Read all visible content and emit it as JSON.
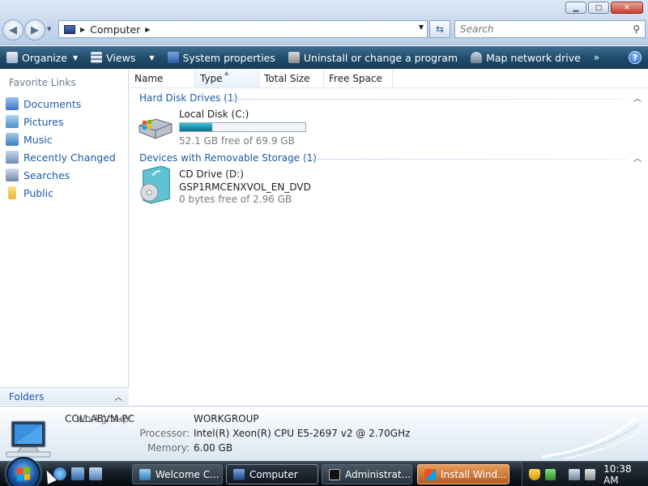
{
  "window": {
    "address_crumb": "Computer",
    "search_placeholder": "Search",
    "minimize": "▁",
    "maximize": "▢",
    "close": "✕"
  },
  "toolbar": {
    "items": [
      {
        "label": "Organize",
        "icon": "organize-icon",
        "has_dropdown": true
      },
      {
        "label": "Views",
        "icon": "views-icon",
        "has_dropdown": true
      },
      {
        "label": "System properties",
        "icon": "system-properties-icon"
      },
      {
        "label": "Uninstall or change a program",
        "icon": "uninstall-icon"
      },
      {
        "label": "Map network drive",
        "icon": "network-drive-icon"
      }
    ],
    "more": "»",
    "help": "?"
  },
  "navpane": {
    "title": "Favorite Links",
    "items": [
      {
        "label": "Documents",
        "icon": "documents-icon",
        "color": "#3b78c9"
      },
      {
        "label": "Pictures",
        "icon": "pictures-icon",
        "color": "#4a8ec9"
      },
      {
        "label": "Music",
        "icon": "music-icon",
        "color": "#3a7fbf"
      },
      {
        "label": "Recently Changed",
        "icon": "recently-changed-icon",
        "color": "#6b8fb8"
      },
      {
        "label": "Searches",
        "icon": "searches-icon",
        "color": "#6f86a8"
      },
      {
        "label": "Public",
        "icon": "public-icon",
        "color": "#e8b631"
      }
    ],
    "folders_label": "Folders"
  },
  "columns": [
    "Name",
    "Type",
    "Total Size",
    "Free Space"
  ],
  "groups": [
    {
      "title": "Hard Disk Drives (1)",
      "drives": [
        {
          "name": "Local Disk (C:)",
          "free_text": "52.1 GB free of 69.9 GB",
          "used_fraction": 0.255,
          "icon": "hard-disk-icon"
        }
      ]
    },
    {
      "title": "Devices with Removable Storage (1)",
      "drives": [
        {
          "name": "CD Drive (D:)",
          "label": "GSP1RMCENXVOL_EN_DVD",
          "free_text": "0 bytes free of 2.96 GB",
          "icon": "cd-drive-icon"
        }
      ]
    }
  ],
  "details": {
    "pc_name": "COLLABVM-PC",
    "rows": [
      {
        "label": "Workgroup:",
        "value": "WORKGROUP"
      },
      {
        "label": "Processor:",
        "value": "Intel(R) Xeon(R) CPU E5-2697 v2 @ 2.70GHz"
      },
      {
        "label": "Memory:",
        "value": "6.00 GB"
      }
    ]
  },
  "taskbar": {
    "tasks": [
      {
        "label": "Welcome C...",
        "state": "normal"
      },
      {
        "label": "Computer",
        "state": "active"
      },
      {
        "label": "Administrat...",
        "state": "normal"
      },
      {
        "label": "Install Wind...",
        "state": "flash"
      }
    ],
    "clock": "10:38 AM"
  }
}
